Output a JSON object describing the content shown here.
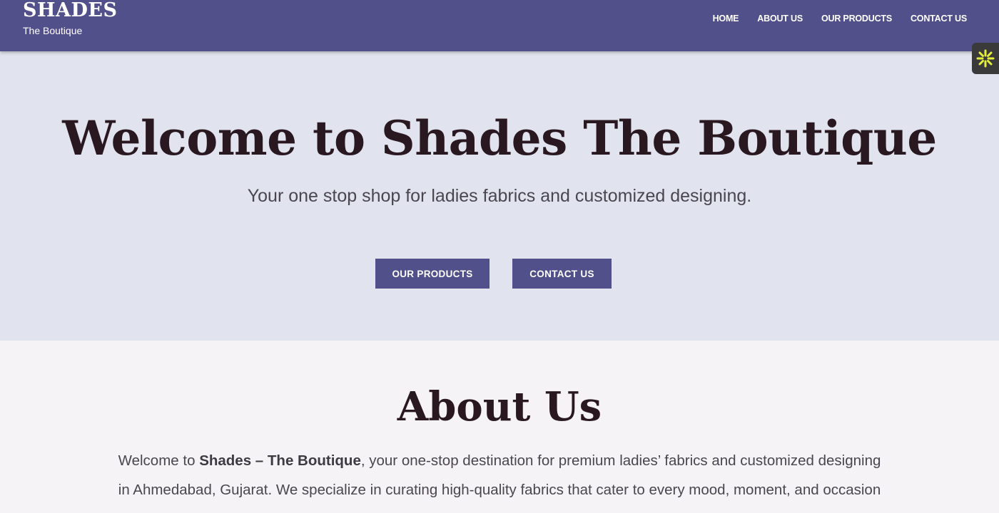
{
  "header": {
    "brand_title": "SHADES",
    "brand_subtitle": "The Boutique",
    "nav": [
      "HOME",
      "ABOUT US",
      "OUR PRODUCTS",
      "CONTACT US"
    ]
  },
  "widget": {
    "icon": "asterisk-sparkle-icon"
  },
  "hero": {
    "title": "Welcome to Shades The Boutique",
    "subtitle": "Your one stop shop for ladies fabrics and customized designing.",
    "buttons": {
      "products": "OUR PRODUCTS",
      "contact": "CONTACT US"
    }
  },
  "about": {
    "title": "About Us",
    "text_prefix": "Welcome to ",
    "text_bold": "Shades – The Boutique",
    "text_rest": ", your one-stop destination for premium ladies’ fabrics and customized designing in Ahmedabad, Gujarat. We specialize in curating high-quality fabrics that cater to every mood, moment, and occasion"
  },
  "colors": {
    "header_bg": "#51508a",
    "hero_bg": "#e1e3ee",
    "heading_text": "#2a1820",
    "widget_icon": "#e4ee3c"
  }
}
